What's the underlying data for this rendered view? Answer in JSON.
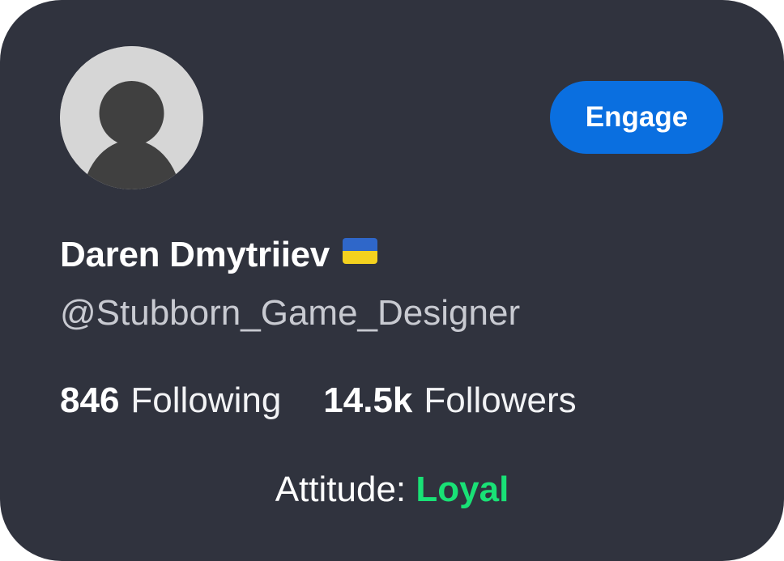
{
  "profile": {
    "name": "Daren Dmytriiev",
    "flag_icon": "ukraine-flag-icon",
    "handle": "@Stubborn_Game_Designer",
    "avatar_icon": "default-user-avatar-icon"
  },
  "engage_button": {
    "label": "Engage"
  },
  "stats": {
    "following": {
      "value": "846",
      "label": "Following"
    },
    "followers": {
      "value": "14.5k",
      "label": "Followers"
    }
  },
  "attitude": {
    "label": "Attitude:",
    "value": "Loyal"
  },
  "colors": {
    "card_background": "#30333e",
    "button_blue": "#0a6fe0",
    "attitude_green": "#19e176",
    "avatar_background": "#d6d6d6",
    "avatar_silhouette": "#404040"
  }
}
